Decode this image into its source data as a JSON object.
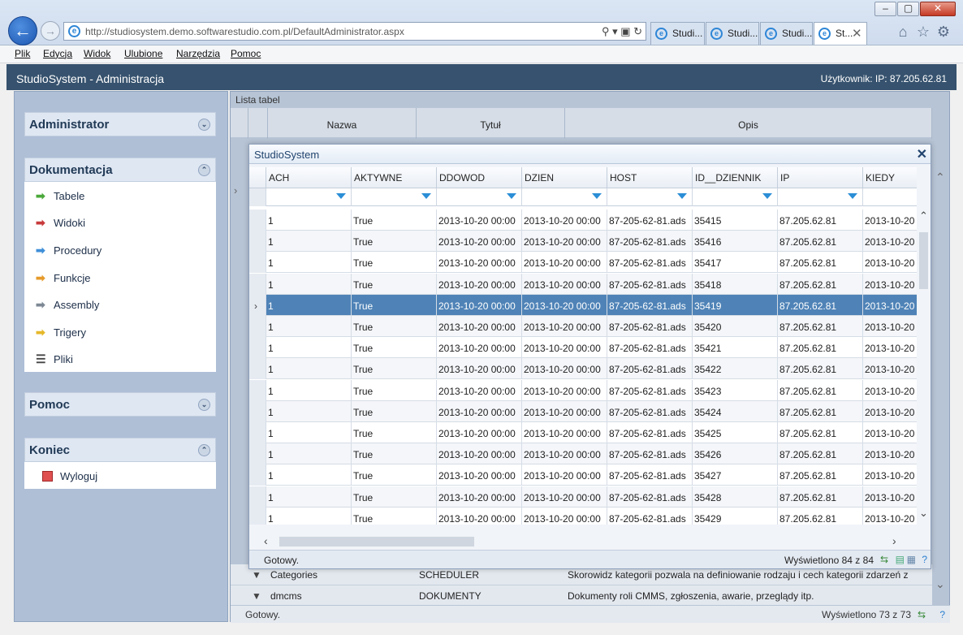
{
  "browser": {
    "url": "http://studiosystem.demo.softwarestudio.com.pl/DefaultAdministrator.aspx",
    "tabs": [
      "Studi...",
      "Studi...",
      "Studi...",
      "St..."
    ],
    "menu": [
      "Plik",
      "Edycja",
      "Widok",
      "Ulubione",
      "Narzędzia",
      "Pomoc"
    ]
  },
  "app": {
    "title": "StudioSystem - Administracja",
    "user": "Użytkownik: IP: 87.205.62.81"
  },
  "sidebar": {
    "sections": [
      {
        "title": "Administrator",
        "expanded": false
      },
      {
        "title": "Dokumentacja",
        "expanded": true
      },
      {
        "title": "Pomoc",
        "expanded": false
      },
      {
        "title": "Koniec",
        "expanded": true
      }
    ],
    "doc_items": [
      {
        "label": "Tabele",
        "icon": "green-arrow-icon",
        "color": "#4aa83a"
      },
      {
        "label": "Widoki",
        "icon": "red-arrow-icon",
        "color": "#c83a3a"
      },
      {
        "label": "Procedury",
        "icon": "blue-arrow-icon",
        "color": "#3f8fd8"
      },
      {
        "label": "Funkcje",
        "icon": "orange-arrow-icon",
        "color": "#e69a2a"
      },
      {
        "label": "Assembly",
        "icon": "gray-arrow-icon",
        "color": "#7d8894"
      },
      {
        "label": "Trigery",
        "icon": "yellow-arrow-icon",
        "color": "#e6b82a"
      },
      {
        "label": "Pliki",
        "icon": "list-icon",
        "color": "#444444"
      }
    ],
    "logout_label": "Wyloguj"
  },
  "background_grid": {
    "title": "Lista tabel",
    "columns": [
      "Nazwa",
      "Tytuł",
      "Opis"
    ],
    "rows": [
      {
        "nazwa": "Categories",
        "tytul": "SCHEDULER",
        "opis": "Skorowidz kategorii pozwala na definiowanie rodzaju i cech kategorii zdarzeń z"
      },
      {
        "nazwa": "dmcms",
        "tytul": "DOKUMENTY",
        "opis": "Dokumenty roli CMMS, zgłoszenia, awarie, przeglądy itp."
      }
    ],
    "status": "Gotowy.",
    "count": "Wyświetlono 73 z 73"
  },
  "modal": {
    "title": "StudioSystem",
    "columns": [
      "ACH",
      "AKTYWNE",
      "DDOWOD",
      "DZIEN",
      "HOST",
      "ID__DZIENNIK",
      "IP",
      "KIEDY"
    ],
    "rows": [
      [
        "1",
        "True",
        "2013-10-20 00:00",
        "2013-10-20 00:00",
        "87-205-62-81.ads",
        "35415",
        "87.205.62.81",
        "2013-10-20"
      ],
      [
        "1",
        "True",
        "2013-10-20 00:00",
        "2013-10-20 00:00",
        "87-205-62-81.ads",
        "35416",
        "87.205.62.81",
        "2013-10-20"
      ],
      [
        "1",
        "True",
        "2013-10-20 00:00",
        "2013-10-20 00:00",
        "87-205-62-81.ads",
        "35417",
        "87.205.62.81",
        "2013-10-20"
      ],
      [
        "1",
        "True",
        "2013-10-20 00:00",
        "2013-10-20 00:00",
        "87-205-62-81.ads",
        "35418",
        "87.205.62.81",
        "2013-10-20"
      ],
      [
        "1",
        "True",
        "2013-10-20 00:00",
        "2013-10-20 00:00",
        "87-205-62-81.ads",
        "35419",
        "87.205.62.81",
        "2013-10-20"
      ],
      [
        "1",
        "True",
        "2013-10-20 00:00",
        "2013-10-20 00:00",
        "87-205-62-81.ads",
        "35420",
        "87.205.62.81",
        "2013-10-20"
      ],
      [
        "1",
        "True",
        "2013-10-20 00:00",
        "2013-10-20 00:00",
        "87-205-62-81.ads",
        "35421",
        "87.205.62.81",
        "2013-10-20"
      ],
      [
        "1",
        "True",
        "2013-10-20 00:00",
        "2013-10-20 00:00",
        "87-205-62-81.ads",
        "35422",
        "87.205.62.81",
        "2013-10-20"
      ],
      [
        "1",
        "True",
        "2013-10-20 00:00",
        "2013-10-20 00:00",
        "87-205-62-81.ads",
        "35423",
        "87.205.62.81",
        "2013-10-20"
      ],
      [
        "1",
        "True",
        "2013-10-20 00:00",
        "2013-10-20 00:00",
        "87-205-62-81.ads",
        "35424",
        "87.205.62.81",
        "2013-10-20"
      ],
      [
        "1",
        "True",
        "2013-10-20 00:00",
        "2013-10-20 00:00",
        "87-205-62-81.ads",
        "35425",
        "87.205.62.81",
        "2013-10-20"
      ],
      [
        "1",
        "True",
        "2013-10-20 00:00",
        "2013-10-20 00:00",
        "87-205-62-81.ads",
        "35426",
        "87.205.62.81",
        "2013-10-20"
      ],
      [
        "1",
        "True",
        "2013-10-20 00:00",
        "2013-10-20 00:00",
        "87-205-62-81.ads",
        "35427",
        "87.205.62.81",
        "2013-10-20"
      ],
      [
        "1",
        "True",
        "2013-10-20 00:00",
        "2013-10-20 00:00",
        "87-205-62-81.ads",
        "35428",
        "87.205.62.81",
        "2013-10-20"
      ],
      [
        "1",
        "True",
        "2013-10-20 00:00",
        "2013-10-20 00:00",
        "87-205-62-81.ads",
        "35429",
        "87.205.62.81",
        "2013-10-20"
      ]
    ],
    "selected_row": 4,
    "status": "Gotowy.",
    "count": "Wyświetlono 84 z 84",
    "colors": {
      "selected": "#4f83b7",
      "header": "#36526e",
      "filter_icon": "#2b8ed6"
    }
  }
}
